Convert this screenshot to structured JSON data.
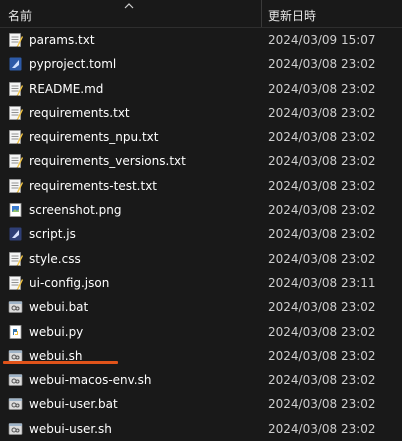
{
  "header": {
    "name_label": "名前",
    "date_label": "更新日時"
  },
  "files": [
    {
      "name": "params.txt",
      "date": "2024/03/09 15:07",
      "icon": "text-file-icon"
    },
    {
      "name": "pyproject.toml",
      "date": "2024/03/08 23:02",
      "icon": "toml-file-icon"
    },
    {
      "name": "README.md",
      "date": "2024/03/08 23:02",
      "icon": "text-file-icon"
    },
    {
      "name": "requirements.txt",
      "date": "2024/03/08 23:02",
      "icon": "text-file-icon"
    },
    {
      "name": "requirements_npu.txt",
      "date": "2024/03/08 23:02",
      "icon": "text-file-icon"
    },
    {
      "name": "requirements_versions.txt",
      "date": "2024/03/08 23:02",
      "icon": "text-file-icon"
    },
    {
      "name": "requirements-test.txt",
      "date": "2024/03/08 23:02",
      "icon": "text-file-icon"
    },
    {
      "name": "screenshot.png",
      "date": "2024/03/08 23:02",
      "icon": "image-file-icon"
    },
    {
      "name": "script.js",
      "date": "2024/03/08 23:02",
      "icon": "js-file-icon"
    },
    {
      "name": "style.css",
      "date": "2024/03/08 23:02",
      "icon": "text-file-icon"
    },
    {
      "name": "ui-config.json",
      "date": "2024/03/08 23:11",
      "icon": "text-file-icon"
    },
    {
      "name": "webui.bat",
      "date": "2024/03/08 23:02",
      "icon": "batch-file-icon"
    },
    {
      "name": "webui.py",
      "date": "2024/03/08 23:02",
      "icon": "python-file-icon"
    },
    {
      "name": "webui.sh",
      "date": "2024/03/08 23:02",
      "icon": "batch-file-icon"
    },
    {
      "name": "webui-macos-env.sh",
      "date": "2024/03/08 23:02",
      "icon": "batch-file-icon"
    },
    {
      "name": "webui-user.bat",
      "date": "2024/03/08 23:02",
      "icon": "batch-file-icon"
    },
    {
      "name": "webui-user.sh",
      "date": "2024/03/08 23:02",
      "icon": "batch-file-icon"
    }
  ],
  "colors": {
    "background": "#191919",
    "highlight_underline": "#e0531a"
  }
}
